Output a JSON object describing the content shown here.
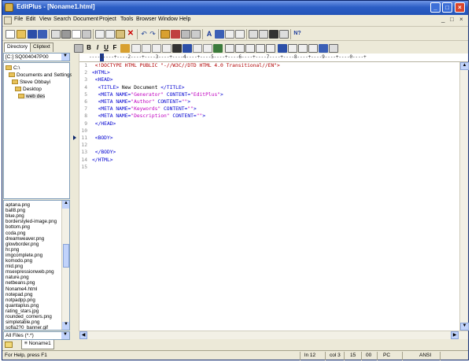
{
  "window": {
    "title": "EditPlus - [Noname1.html]",
    "min_glyph": "_",
    "max_glyph": "□",
    "close_glyph": "×"
  },
  "menu": {
    "items": [
      "File",
      "Edit",
      "View",
      "Search",
      "Document",
      "Project",
      "Tools",
      "Browser",
      "Window",
      "Help"
    ],
    "right_glyphs": [
      "_",
      "□",
      "×"
    ]
  },
  "format_toolbar": {
    "bold": "B",
    "italic": "I",
    "underline": "U",
    "font": "F"
  },
  "sidebar": {
    "tabs": [
      "Directory",
      "Cliptext"
    ],
    "drive": "[C:] SQ004047P00",
    "tree": [
      "C:\\",
      "Documents and Settings",
      "Steve Obbayi",
      "Desktop",
      "web des"
    ],
    "files": [
      "aptana.png",
      "ball8.png",
      "blue.png",
      "borderstyled-image.png",
      "bottom.png",
      "coda.png",
      "dreamweaver.png",
      "glowborder.png",
      "hr.png",
      "imgcomplete.png",
      "komodo.png",
      "mid.png",
      "msexpressionweb.png",
      "nature.png",
      "netbeans.png",
      "Noname4.html",
      "notepad.png",
      "notpadpp.png",
      "quantaplus.png",
      "rating_stars.jpg",
      "rounded_corners.png",
      "simpletable.png",
      "sofla2?0_banner.gif"
    ],
    "filter": "All Files (*.*)"
  },
  "editor": {
    "ruler": "----1----+----2----+----3----+----4----+----5----+----6----+----7----+----8----+----9----+----0----+",
    "lines": [
      {
        "n": "1",
        "parts": [
          {
            "t": " <!DOCTYPE HTML PUBLIC \"-//W3C//DTD HTML 4.0 Transitional//EN\">",
            "c": "c-red"
          }
        ]
      },
      {
        "n": "2",
        "parts": [
          {
            "t": "<HTML>",
            "c": "c-blue"
          }
        ]
      },
      {
        "n": "3",
        "parts": [
          {
            "t": " <HEAD>",
            "c": "c-blue"
          }
        ]
      },
      {
        "n": "4",
        "parts": [
          {
            "t": "  <TITLE>",
            "c": "c-blue"
          },
          {
            "t": " New Document ",
            "c": "c-black"
          },
          {
            "t": "</TITLE>",
            "c": "c-blue"
          }
        ]
      },
      {
        "n": "5",
        "parts": [
          {
            "t": "  <META NAME=",
            "c": "c-blue"
          },
          {
            "t": "\"Generator\"",
            "c": "c-mag"
          },
          {
            "t": " CONTENT=",
            "c": "c-blue"
          },
          {
            "t": "\"EditPlus\"",
            "c": "c-mag"
          },
          {
            "t": ">",
            "c": "c-blue"
          }
        ]
      },
      {
        "n": "6",
        "parts": [
          {
            "t": "  <META NAME=",
            "c": "c-blue"
          },
          {
            "t": "\"Author\"",
            "c": "c-mag"
          },
          {
            "t": " CONTENT=",
            "c": "c-blue"
          },
          {
            "t": "\"\"",
            "c": "c-mag"
          },
          {
            "t": ">",
            "c": "c-blue"
          }
        ]
      },
      {
        "n": "7",
        "parts": [
          {
            "t": "  <META NAME=",
            "c": "c-blue"
          },
          {
            "t": "\"Keywords\"",
            "c": "c-mag"
          },
          {
            "t": " CONTENT=",
            "c": "c-blue"
          },
          {
            "t": "\"\"",
            "c": "c-mag"
          },
          {
            "t": ">",
            "c": "c-blue"
          }
        ]
      },
      {
        "n": "8",
        "parts": [
          {
            "t": "  <META NAME=",
            "c": "c-blue"
          },
          {
            "t": "\"Description\"",
            "c": "c-mag"
          },
          {
            "t": " CONTENT=",
            "c": "c-blue"
          },
          {
            "t": "\"\"",
            "c": "c-mag"
          },
          {
            "t": ">",
            "c": "c-blue"
          }
        ]
      },
      {
        "n": "9",
        "parts": [
          {
            "t": " </HEAD>",
            "c": "c-blue"
          }
        ]
      },
      {
        "n": "10",
        "parts": []
      },
      {
        "n": "11",
        "parts": [
          {
            "t": " <BODY>",
            "c": "c-blue"
          }
        ]
      },
      {
        "n": "12",
        "parts": []
      },
      {
        "n": "13",
        "parts": [
          {
            "t": " </BODY>",
            "c": "c-blue"
          }
        ]
      },
      {
        "n": "14",
        "parts": [
          {
            "t": "</HTML>",
            "c": "c-blue"
          }
        ]
      },
      {
        "n": "15",
        "parts": []
      }
    ]
  },
  "doc_tab": "≡ Noname1",
  "status": {
    "help": "For Help, press F1",
    "line": "ln 12",
    "col": "col 3",
    "a": "15",
    "b": "00",
    "eol": "PC",
    "encoding": "ANSI"
  }
}
